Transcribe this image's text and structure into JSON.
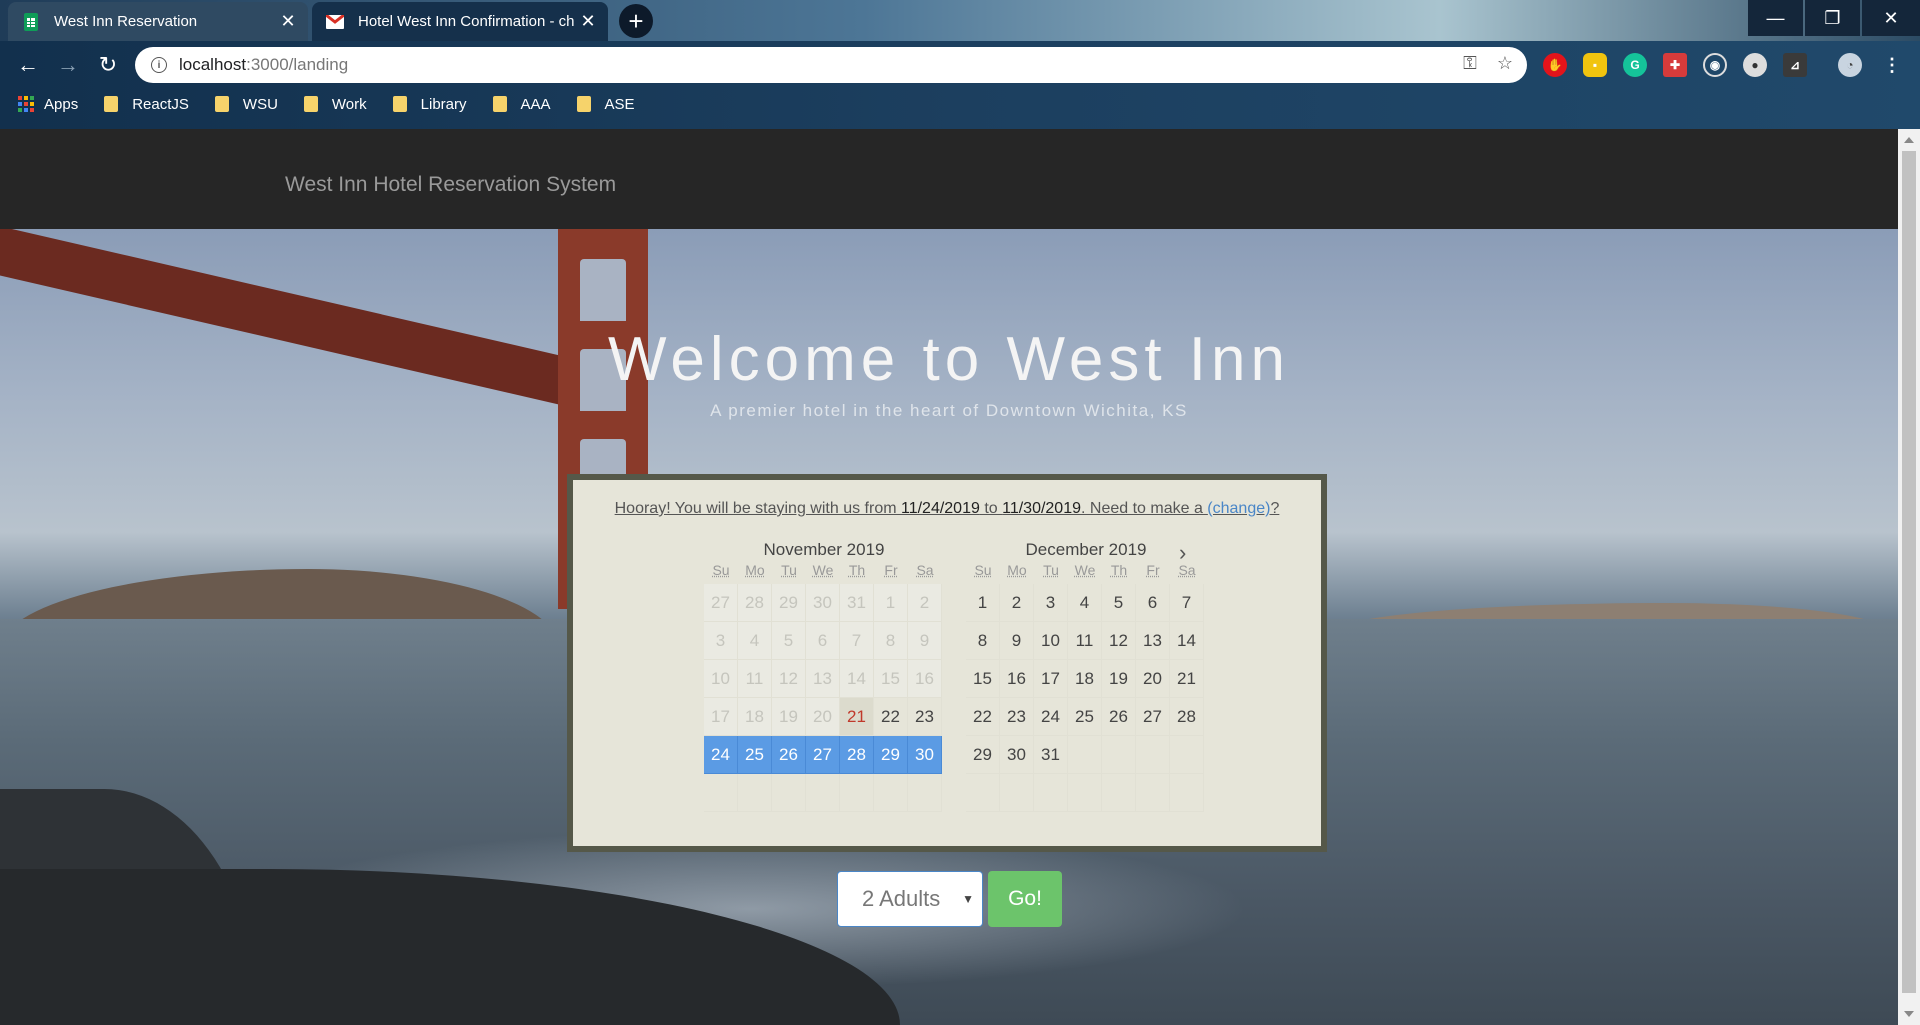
{
  "browser": {
    "tabs": [
      {
        "title": "West Inn Reservation",
        "icon": "sheets-icon",
        "active": true
      },
      {
        "title": "Hotel West Inn Confirmation - ch",
        "icon": "gmail-icon",
        "active": false
      }
    ],
    "url_host": "localhost",
    "url_path": ":3000/landing",
    "bookmarks": [
      "Apps",
      "ReactJS",
      "WSU",
      "Work",
      "Library",
      "AAA",
      "ASE"
    ]
  },
  "navbar": {
    "brand": "West Inn Hotel Reservation System"
  },
  "hero": {
    "title": "Welcome to West Inn",
    "subtitle": "A premier hotel in the heart of Downtown Wichita, KS"
  },
  "reservation": {
    "message_prefix": "Hooray! You will be staying with us from ",
    "checkin": "11/24/2019",
    "message_mid": " to ",
    "checkout": "11/30/2019",
    "message_suffix": ". Need to make a ",
    "change_link": "(change)",
    "message_end": "?"
  },
  "calendar": {
    "weekdays": [
      "Su",
      "Mo",
      "Tu",
      "We",
      "Th",
      "Fr",
      "Sa"
    ],
    "months": [
      {
        "title": "November 2019",
        "days": [
          {
            "d": "27",
            "s": "disabled"
          },
          {
            "d": "28",
            "s": "disabled"
          },
          {
            "d": "29",
            "s": "disabled"
          },
          {
            "d": "30",
            "s": "disabled"
          },
          {
            "d": "31",
            "s": "disabled"
          },
          {
            "d": "1",
            "s": "disabled"
          },
          {
            "d": "2",
            "s": "disabled"
          },
          {
            "d": "3",
            "s": "disabled"
          },
          {
            "d": "4",
            "s": "disabled"
          },
          {
            "d": "5",
            "s": "disabled"
          },
          {
            "d": "6",
            "s": "disabled"
          },
          {
            "d": "7",
            "s": "disabled"
          },
          {
            "d": "8",
            "s": "disabled"
          },
          {
            "d": "9",
            "s": "disabled"
          },
          {
            "d": "10",
            "s": "disabled"
          },
          {
            "d": "11",
            "s": "disabled"
          },
          {
            "d": "12",
            "s": "disabled"
          },
          {
            "d": "13",
            "s": "disabled"
          },
          {
            "d": "14",
            "s": "disabled"
          },
          {
            "d": "15",
            "s": "disabled"
          },
          {
            "d": "16",
            "s": "disabled"
          },
          {
            "d": "17",
            "s": "disabled"
          },
          {
            "d": "18",
            "s": "disabled"
          },
          {
            "d": "19",
            "s": "disabled"
          },
          {
            "d": "20",
            "s": "disabled"
          },
          {
            "d": "21",
            "s": "today"
          },
          {
            "d": "22",
            "s": ""
          },
          {
            "d": "23",
            "s": ""
          },
          {
            "d": "24",
            "s": "selected"
          },
          {
            "d": "25",
            "s": "selected"
          },
          {
            "d": "26",
            "s": "selected"
          },
          {
            "d": "27",
            "s": "selected"
          },
          {
            "d": "28",
            "s": "selected"
          },
          {
            "d": "29",
            "s": "selected"
          },
          {
            "d": "30",
            "s": "selected"
          },
          {
            "d": "",
            "s": "empty"
          },
          {
            "d": "",
            "s": "empty"
          },
          {
            "d": "",
            "s": "empty"
          },
          {
            "d": "",
            "s": "empty"
          },
          {
            "d": "",
            "s": "empty"
          },
          {
            "d": "",
            "s": "empty"
          },
          {
            "d": "",
            "s": "empty"
          }
        ]
      },
      {
        "title": "December 2019",
        "days": [
          {
            "d": "1",
            "s": ""
          },
          {
            "d": "2",
            "s": ""
          },
          {
            "d": "3",
            "s": ""
          },
          {
            "d": "4",
            "s": ""
          },
          {
            "d": "5",
            "s": ""
          },
          {
            "d": "6",
            "s": ""
          },
          {
            "d": "7",
            "s": ""
          },
          {
            "d": "8",
            "s": ""
          },
          {
            "d": "9",
            "s": ""
          },
          {
            "d": "10",
            "s": ""
          },
          {
            "d": "11",
            "s": ""
          },
          {
            "d": "12",
            "s": ""
          },
          {
            "d": "13",
            "s": ""
          },
          {
            "d": "14",
            "s": ""
          },
          {
            "d": "15",
            "s": ""
          },
          {
            "d": "16",
            "s": ""
          },
          {
            "d": "17",
            "s": ""
          },
          {
            "d": "18",
            "s": ""
          },
          {
            "d": "19",
            "s": ""
          },
          {
            "d": "20",
            "s": ""
          },
          {
            "d": "21",
            "s": ""
          },
          {
            "d": "22",
            "s": ""
          },
          {
            "d": "23",
            "s": ""
          },
          {
            "d": "24",
            "s": ""
          },
          {
            "d": "25",
            "s": ""
          },
          {
            "d": "26",
            "s": ""
          },
          {
            "d": "27",
            "s": ""
          },
          {
            "d": "28",
            "s": ""
          },
          {
            "d": "29",
            "s": ""
          },
          {
            "d": "30",
            "s": ""
          },
          {
            "d": "31",
            "s": ""
          },
          {
            "d": "",
            "s": "empty"
          },
          {
            "d": "",
            "s": "empty"
          },
          {
            "d": "",
            "s": "empty"
          },
          {
            "d": "",
            "s": "empty"
          },
          {
            "d": "",
            "s": "empty"
          },
          {
            "d": "",
            "s": "empty"
          },
          {
            "d": "",
            "s": "empty"
          },
          {
            "d": "",
            "s": "empty"
          },
          {
            "d": "",
            "s": "empty"
          },
          {
            "d": "",
            "s": "empty"
          },
          {
            "d": "",
            "s": "empty"
          }
        ]
      }
    ]
  },
  "controls": {
    "guests_value": "2 Adults",
    "go_label": "Go!"
  },
  "colors": {
    "selected": "#5b9be4",
    "go_button": "#6cc46b",
    "today": "#c0392b",
    "navbar": "#262626"
  }
}
